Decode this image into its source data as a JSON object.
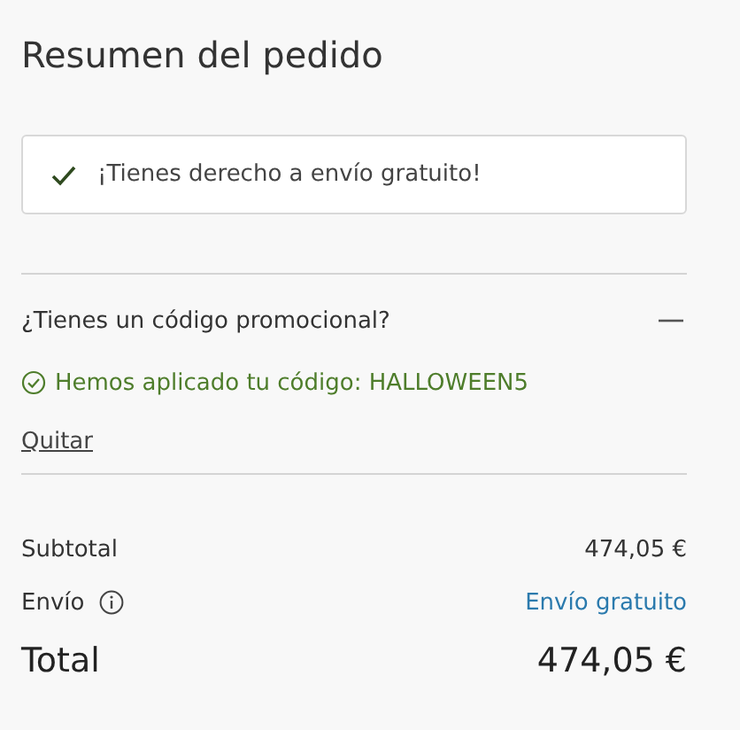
{
  "title": "Resumen del pedido",
  "notice": {
    "text": "¡Tienes derecho a envío gratuito!"
  },
  "promo": {
    "question": "¿Tienes un código promocional?",
    "expanded": true,
    "applied": "Hemos aplicado tu código: HALLOWEEN5",
    "remove": "Quitar"
  },
  "summary": [
    {
      "kind": "plain",
      "label": "Subtotal",
      "value": "474,05 €"
    },
    {
      "kind": "info",
      "label": "Envío",
      "value": "Envío gratuito"
    },
    {
      "kind": "total",
      "label": "Total",
      "value": "474,05 €"
    }
  ]
}
